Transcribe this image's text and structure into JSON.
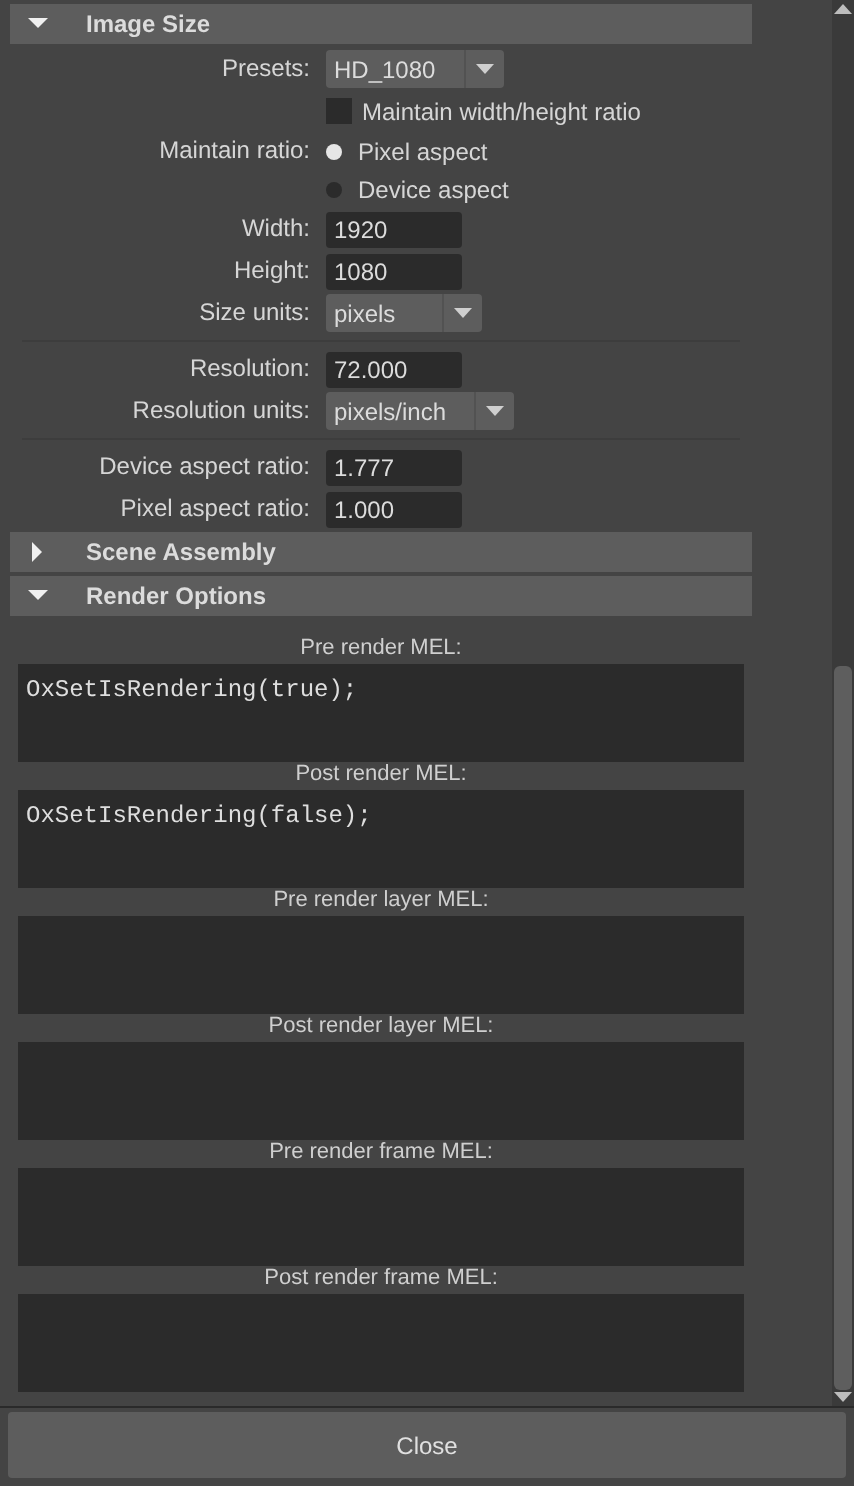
{
  "sections": [
    {
      "kind": "form",
      "title": "Image Size",
      "expanded": true,
      "rows": [
        {
          "kind": "dropdown",
          "label": "Presets:",
          "value": "HD_1080"
        },
        {
          "kind": "checkbox",
          "text": "Maintain width/height ratio",
          "checked": false
        },
        {
          "kind": "radio",
          "label": "Maintain ratio:",
          "text": "Pixel aspect",
          "selected": true
        },
        {
          "kind": "radio",
          "text": "Device aspect",
          "selected": false
        },
        {
          "kind": "field",
          "label": "Width:",
          "value": "1920"
        },
        {
          "kind": "field",
          "label": "Height:",
          "value": "1080"
        },
        {
          "kind": "dropdown",
          "label": "Size units:",
          "value": "pixels"
        },
        {
          "kind": "divider"
        },
        {
          "kind": "field",
          "label": "Resolution:",
          "value": "72.000"
        },
        {
          "kind": "dropdown",
          "label": "Resolution units:",
          "value": "pixels/inch"
        },
        {
          "kind": "divider"
        },
        {
          "kind": "field",
          "label": "Device aspect ratio:",
          "value": "1.777"
        },
        {
          "kind": "field",
          "label": "Pixel aspect ratio:",
          "value": "1.000"
        }
      ]
    },
    {
      "title": "Scene Assembly",
      "expanded": false
    },
    {
      "kind": "scripts",
      "title": "Render Options",
      "expanded": true,
      "scripts": [
        {
          "label": "Pre render MEL:",
          "code": "OxSetIsRendering(true);"
        },
        {
          "label": "Post render MEL:",
          "code": "OxSetIsRendering(false);"
        },
        {
          "label": "Pre render layer MEL:"
        },
        {
          "label": "Post render layer MEL:"
        },
        {
          "label": "Pre render frame MEL:"
        },
        {
          "label": "Post render frame MEL:"
        }
      ]
    }
  ],
  "close_button": "Close"
}
